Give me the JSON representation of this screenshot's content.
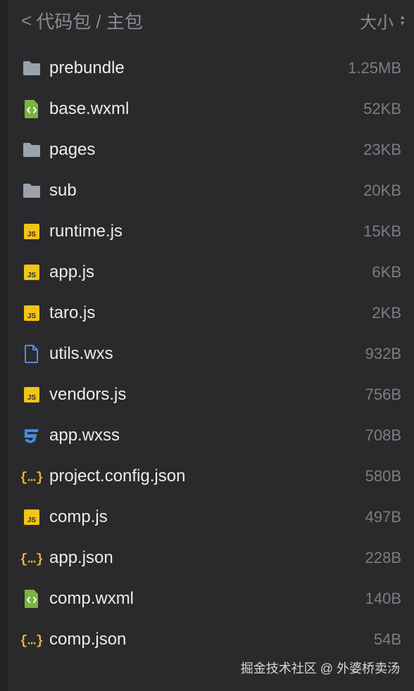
{
  "header": {
    "back_glyph": "<",
    "breadcrumb": "代码包 / 主包",
    "sort_label": "大小"
  },
  "files": [
    {
      "name": "prebundle",
      "size": "1.25MB",
      "icon": "folder-icon"
    },
    {
      "name": "base.wxml",
      "size": "52KB",
      "icon": "wxml-file-icon"
    },
    {
      "name": "pages",
      "size": "23KB",
      "icon": "folder-icon"
    },
    {
      "name": "sub",
      "size": "20KB",
      "icon": "folder-icon"
    },
    {
      "name": "runtime.js",
      "size": "15KB",
      "icon": "js-file-icon"
    },
    {
      "name": "app.js",
      "size": "6KB",
      "icon": "js-file-icon"
    },
    {
      "name": "taro.js",
      "size": "2KB",
      "icon": "js-file-icon"
    },
    {
      "name": "utils.wxs",
      "size": "932B",
      "icon": "document-icon"
    },
    {
      "name": "vendors.js",
      "size": "756B",
      "icon": "js-file-icon"
    },
    {
      "name": "app.wxss",
      "size": "708B",
      "icon": "css-file-icon"
    },
    {
      "name": "project.config.json",
      "size": "580B",
      "icon": "json-file-icon"
    },
    {
      "name": "comp.js",
      "size": "497B",
      "icon": "js-file-icon"
    },
    {
      "name": "app.json",
      "size": "228B",
      "icon": "json-file-icon"
    },
    {
      "name": "comp.wxml",
      "size": "140B",
      "icon": "wxml-file-icon"
    },
    {
      "name": "comp.json",
      "size": "54B",
      "icon": "json-file-icon"
    }
  ],
  "watermark": "掘金技术社区 @ 外婆桥卖汤",
  "colors": {
    "background": "#2a2a2c",
    "folder": "#9aa3ad",
    "js": "#f0c419",
    "wxml": "#7cb342",
    "css": "#3f8fe6",
    "json": "#e8b53a",
    "document": "#4a90e2"
  }
}
